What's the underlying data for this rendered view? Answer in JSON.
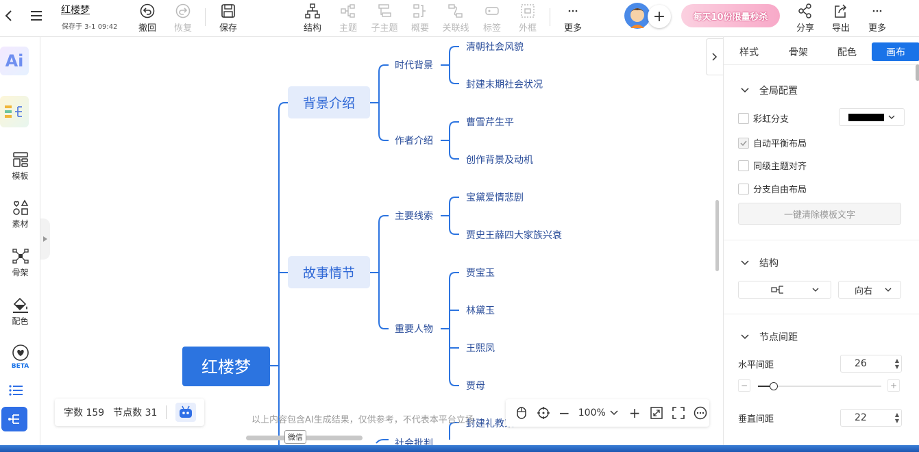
{
  "doc": {
    "title": "红楼梦",
    "saved": "保存于 3-1 09:42"
  },
  "toolbar": {
    "undo": "撤回",
    "redo": "恢复",
    "save": "保存",
    "structure": "结构",
    "topic": "主题",
    "subtopic": "子主题",
    "summary": "概要",
    "relation": "关联线",
    "tag": "标签",
    "frame": "外框",
    "more": "更多",
    "promo": "每天10份限量秒杀",
    "share": "分享",
    "export": "导出",
    "more2": "更多"
  },
  "leftbar": {
    "ai": "Ai",
    "template": "模板",
    "material": "素材",
    "skeleton": "骨架",
    "color": "配色",
    "beta": "BETA"
  },
  "mindmap": {
    "root": "红楼梦",
    "l1": [
      "背景介绍",
      "故事情节"
    ],
    "l2": [
      "时代背景",
      "作者介绍",
      "主要线索",
      "重要人物",
      "社会批判"
    ],
    "l3": [
      "清朝社会风貌",
      "封建末期社会状况",
      "曹雪芹生平",
      "创作背景及动机",
      "宝黛爱情悲剧",
      "贾史王薛四大家族兴衰",
      "贾宝玉",
      "林黛玉",
      "王熙凤",
      "贾母",
      "封建礼教束"
    ]
  },
  "status": {
    "word_count": "字数 159",
    "node_count": "节点数 31"
  },
  "ai_disclaimer": "以上内容包含AI生成结果，仅供参考，不代表本平台立场",
  "wechat_tip": "微信",
  "zoom": {
    "level": "100%"
  },
  "panel": {
    "tabs": [
      "样式",
      "骨架",
      "配色",
      "画布"
    ],
    "global": "全局配置",
    "rainbow": "彩虹分支",
    "auto_balance": "自动平衡布局",
    "same_level_align": "同级主题对齐",
    "free_layout": "分支自由布局",
    "clear_btn": "一键清除模板文字",
    "structure": "结构",
    "structure_dir": "向右",
    "node_spacing": "节点间距",
    "h_spacing_label": "水平间距",
    "h_spacing": "26",
    "v_spacing_label": "垂直间距",
    "v_spacing": "22",
    "h_slider_fraction": 0.13
  },
  "colors": {
    "accent": "#1a73e8",
    "root": "#2c74e0",
    "l1_bg": "#e4ecfb",
    "line": "#2c74e0"
  }
}
